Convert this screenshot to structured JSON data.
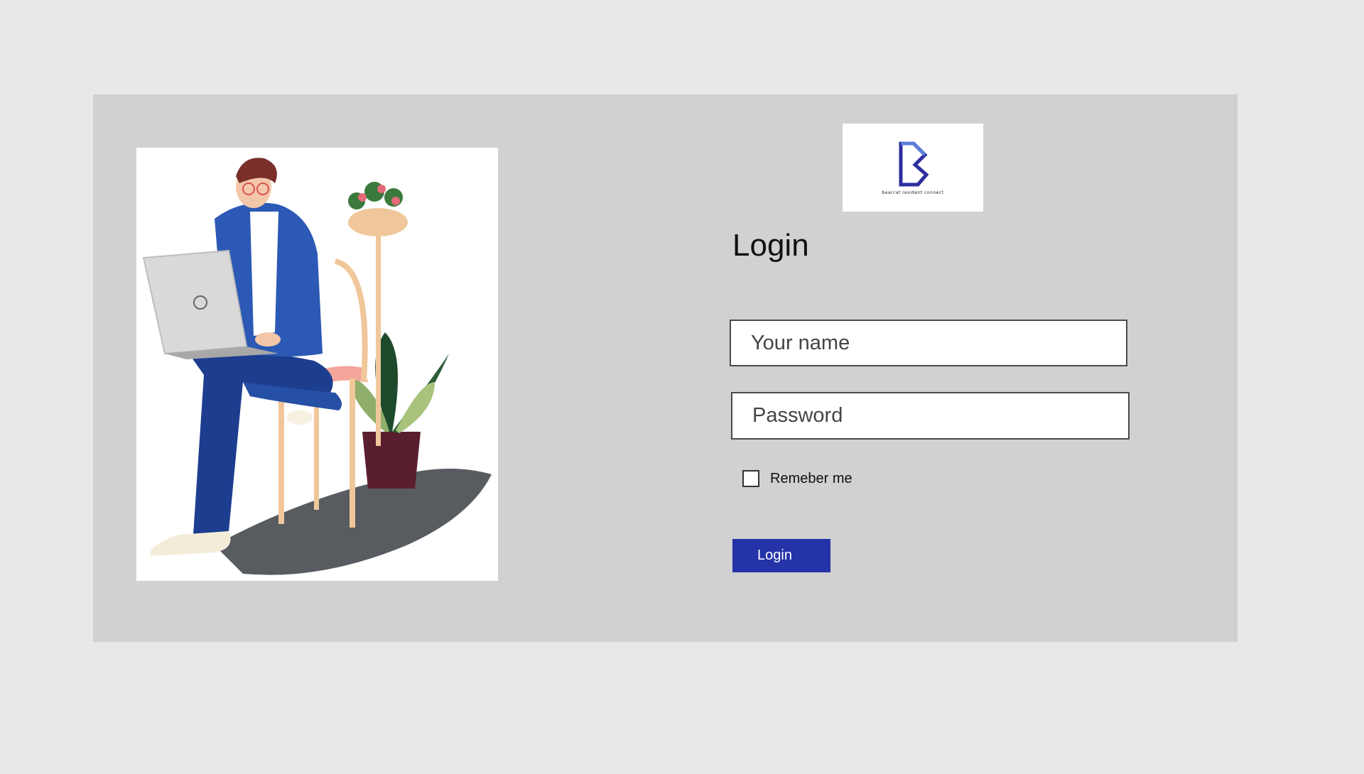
{
  "logo": {
    "brand_text": "bearcat resident connect",
    "brand_color": "#3a3aa8"
  },
  "form": {
    "title": "Login",
    "name_placeholder": "Your name",
    "name_value": "",
    "password_placeholder": "Password",
    "password_value": "",
    "remember_label": "Remeber me",
    "remember_checked": false,
    "submit_label": "Login"
  },
  "colors": {
    "page_background": "#e8e8e8",
    "panel_background": "#d1d1d1",
    "button_background": "#2533a8",
    "button_text": "#ffffff"
  },
  "illustration": {
    "subject": "person-with-laptop-on-chair-with-plants"
  }
}
